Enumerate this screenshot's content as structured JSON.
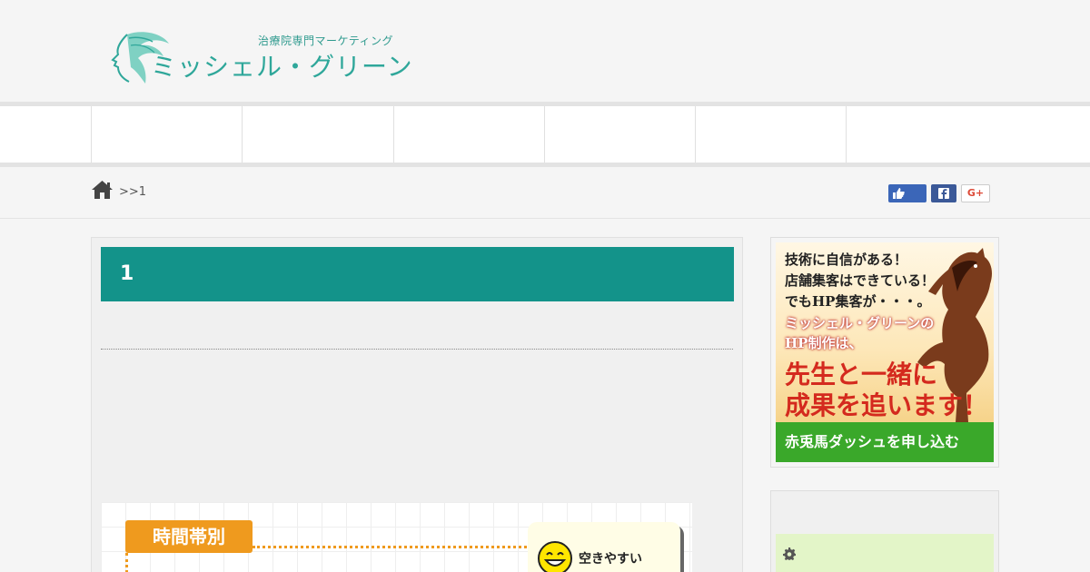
{
  "header": {
    "tagline": "治療院専門マーケティング",
    "brand_name": "ミッシェル・グリーン"
  },
  "breadcrumb": {
    "text": ">>1"
  },
  "share": {
    "gplus_label": "G+"
  },
  "article": {
    "title": "1"
  },
  "chart_card": {
    "badge": "時間帯別",
    "legend_label": "空きやすい"
  },
  "banner": {
    "lines": [
      "技術に自信がある！",
      "店舗集客はできている！",
      "でもHP集客が・・・。",
      "ミッシェル・グリーンの",
      "HP制作は、",
      "先生と一緒に",
      "成果を追います！"
    ],
    "cta": "赤兎馬ダッシュを申し込む"
  },
  "colors": {
    "accent": "#13938a",
    "brand": "#2fa79a",
    "badge": "#ef9a1e",
    "cta": "#3aa82a"
  }
}
